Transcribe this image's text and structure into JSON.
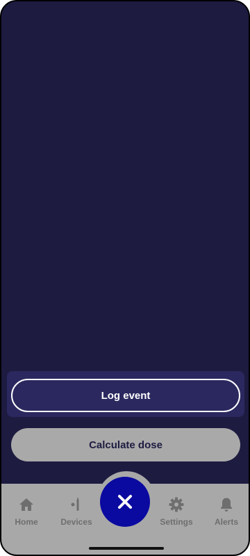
{
  "actions": {
    "log_event_label": "Log event",
    "calculate_dose_label": "Calculate dose"
  },
  "fab": {
    "icon": "close-icon"
  },
  "nav": {
    "items": [
      {
        "label": "Home",
        "icon": "home-icon"
      },
      {
        "label": "Devices",
        "icon": "devices-icon"
      },
      {
        "label": "Settings",
        "icon": "gear-icon"
      },
      {
        "label": "Alerts",
        "icon": "bell-icon"
      }
    ]
  },
  "colors": {
    "background": "#1d1b40",
    "panel": "#2b285f",
    "nav_bar": "#a8a8a8",
    "fab": "#0a0aa0",
    "nav_icon": "#6e6e6e"
  }
}
